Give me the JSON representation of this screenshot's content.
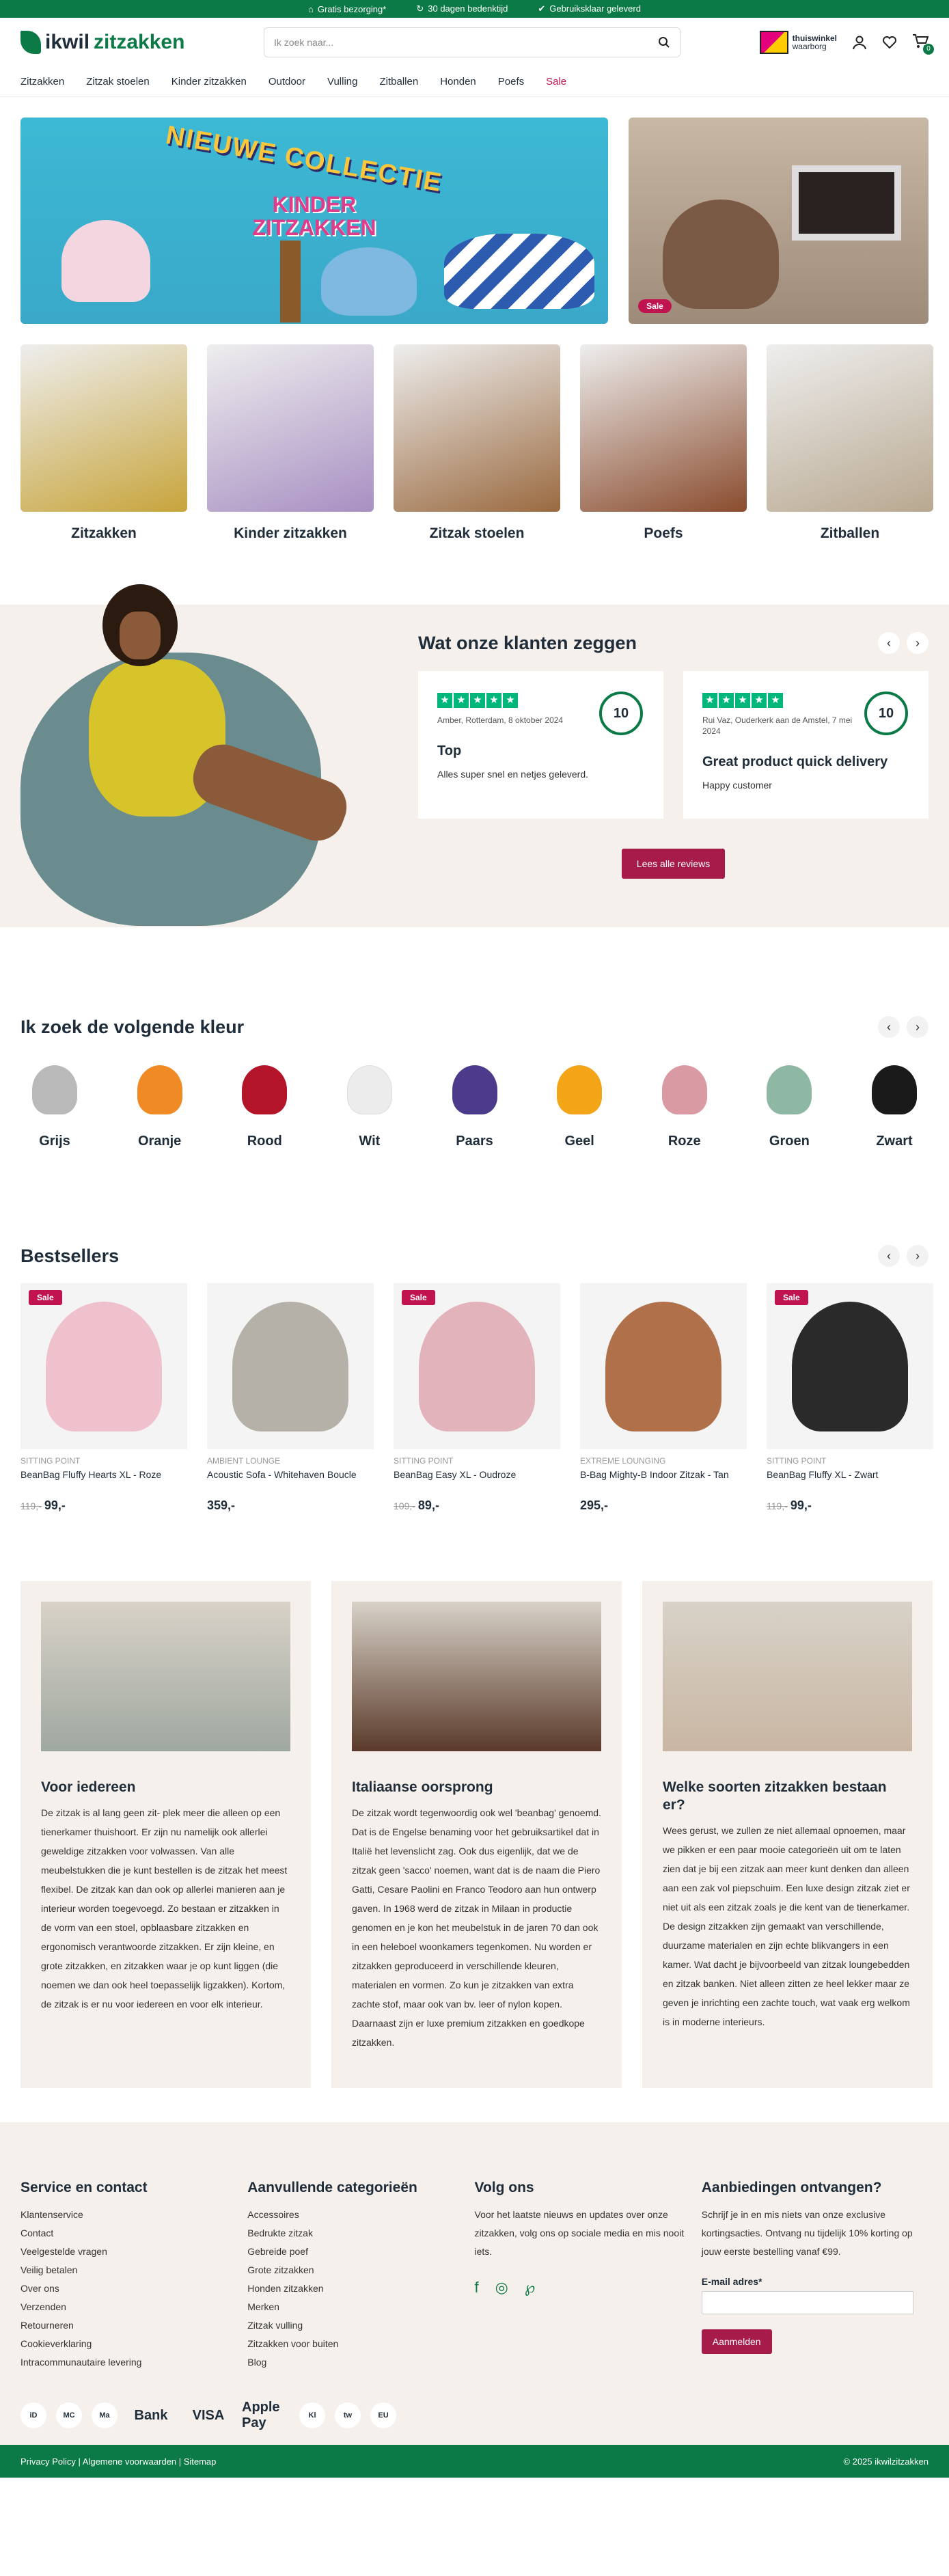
{
  "topbar": [
    "Gratis bezorging*",
    "30 dagen bedenktijd",
    "Gebruiksklaar geleverd"
  ],
  "header": {
    "logo_a": "ikwil",
    "logo_b": "zitzakken",
    "search_placeholder": "Ik zoek naar...",
    "thuiswinkel_1": "thuiswinkel",
    "thuiswinkel_2": "waarborg",
    "cart_count": "0"
  },
  "nav": [
    "Zitzakken",
    "Zitzak stoelen",
    "Kinder zitzakken",
    "Outdoor",
    "Vulling",
    "Zitballen",
    "Honden",
    "Poefs"
  ],
  "nav_sale": "Sale",
  "hero": {
    "title_1": "NIEUWE COLLECTIE",
    "title_2": "KINDER ZITZAKKEN",
    "side_badge": "Sale"
  },
  "categories": [
    {
      "label": "Zitzakken",
      "color": "#c7a43b"
    },
    {
      "label": "Kinder zitzakken",
      "color": "#a88fc2"
    },
    {
      "label": "Zitzak stoelen",
      "color": "#9a6a40"
    },
    {
      "label": "Poefs",
      "color": "#8a4c2e"
    },
    {
      "label": "Zitballen",
      "color": "#b8a890"
    }
  ],
  "reviews": {
    "title": "Wat onze klanten zeggen",
    "cards": [
      {
        "meta": "Amber, Rotterdam, 8 oktober 2024",
        "score": "10",
        "title": "Top",
        "text": "Alles super snel en netjes geleverd."
      },
      {
        "meta": "Rui Vaz, Ouderkerk aan de Amstel, 7 mei 2024",
        "score": "10",
        "title": "Great product quick delivery",
        "text": "Happy customer"
      }
    ],
    "button": "Lees alle reviews"
  },
  "colors_section": {
    "title": "Ik zoek de volgende kleur",
    "items": [
      {
        "label": "Grijs",
        "color": "#b9b9b9"
      },
      {
        "label": "Oranje",
        "color": "#f08a24"
      },
      {
        "label": "Rood",
        "color": "#b3142a"
      },
      {
        "label": "Wit",
        "color": "#ececec"
      },
      {
        "label": "Paars",
        "color": "#4c3a8a"
      },
      {
        "label": "Geel",
        "color": "#f4a417"
      },
      {
        "label": "Roze",
        "color": "#d99aa3"
      },
      {
        "label": "Groen",
        "color": "#8fb8a4"
      },
      {
        "label": "Zwart",
        "color": "#1a1a1a"
      }
    ]
  },
  "bestsellers": {
    "title": "Bestsellers",
    "sale_label": "Sale",
    "products": [
      {
        "brand": "SITTING POINT",
        "name": "BeanBag Fluffy Hearts XL - Roze",
        "old": "119,-",
        "price": "99,-",
        "sale": true,
        "color": "#efc1cd"
      },
      {
        "brand": "AMBIENT LOUNGE",
        "name": "Acoustic Sofa - Whitehaven Boucle",
        "old": "",
        "price": "359,-",
        "sale": false,
        "color": "#b5b1a8"
      },
      {
        "brand": "SITTING POINT",
        "name": "BeanBag Easy XL - Oudroze",
        "old": "109,-",
        "price": "89,-",
        "sale": true,
        "color": "#e3b3bc"
      },
      {
        "brand": "EXTREME LOUNGING",
        "name": "B-Bag Mighty-B Indoor Zitzak - Tan",
        "old": "",
        "price": "295,-",
        "sale": false,
        "color": "#b0704a"
      },
      {
        "brand": "SITTING POINT",
        "name": "BeanBag Fluffy XL - Zwart",
        "old": "119,-",
        "price": "99,-",
        "sale": true,
        "color": "#2a2a2a"
      }
    ]
  },
  "info": [
    {
      "title": "Voor iedereen",
      "color": "#9fa8a0",
      "text": "De zitzak is al lang geen zit- plek meer die alleen op een tienerkamer thuishoort. Er zijn nu namelijk ook allerlei geweldige zitzakken voor volwassen. Van alle meubelstukken die je kunt bestellen is de zitzak het meest flexibel. De zitzak kan dan ook op allerlei manieren aan je interieur worden toegevoegd. Zo bestaan er zitzakken in de vorm van een stoel, opblaasbare zitzakken en ergonomisch verantwoorde zitzakken. Er zijn kleine, en grote zitzakken, en zitzakken waar je op kunt liggen (die noemen we dan ook heel toepasselijk ligzakken). Kortom, de zitzak is er nu voor iedereen en voor elk interieur."
    },
    {
      "title": "Italiaanse oorsprong",
      "color": "#5a3a2a",
      "text": "De zitzak wordt tegenwoordig ook wel 'beanbag' genoemd. Dat is de Engelse benaming voor het gebruiksartikel dat in Italië het levenslicht zag. Ook dus eigenlijk, dat we de zitzak geen 'sacco' noemen, want dat is de naam die Piero Gatti, Cesare Paolini en Franco Teodoro aan hun ontwerp gaven. In 1968 werd de zitzak in Milaan in productie genomen en je kon het meubelstuk in de jaren 70 dan ook in een heleboel woonkamers tegenkomen. Nu worden er zitzakken geproduceerd in verschillende kleuren, materialen en vormen. Zo kun je zitzakken van extra zachte stof, maar ook van bv. leer of nylon kopen. Daarnaast zijn er luxe premium zitzakken en goedkope zitzakken."
    },
    {
      "title": "Welke soorten zitzakken bestaan er?",
      "color": "#c9b6a2",
      "text": "Wees gerust, we zullen ze niet allemaal opnoemen, maar we pikken er een paar mooie categorieën uit om te laten zien dat je bij een zitzak aan meer kunt denken dan alleen aan een zak vol piepschuim. Een luxe design zitzak ziet er niet uit als een zitzak zoals je die kent van de tienerkamer. De design zitzakken zijn gemaakt van verschillende, duurzame materialen en zijn echte blikvangers in een kamer. Wat dacht je bijvoorbeeld van zitzak loungebedden en zitzak banken. Niet alleen zitten ze heel lekker maar ze geven je inrichting een zachte touch, wat vaak erg welkom is in moderne interieurs."
    }
  ],
  "footer": {
    "col1_title": "Service en contact",
    "col1_links": [
      "Klantenservice",
      "Contact",
      "Veelgestelde vragen",
      "Veilig betalen",
      "Over ons",
      "Verzenden",
      "Retourneren",
      "Cookieverklaring",
      "Intracommunautaire levering"
    ],
    "col2_title": "Aanvullende categorieën",
    "col2_links": [
      "Accessoires",
      "Bedrukte zitzak",
      "Gebreide poef",
      "Grote zitzakken",
      "Honden zitzakken",
      "Merken",
      "Zitzak vulling",
      "Zitzakken voor buiten",
      "Blog"
    ],
    "col3_title": "Volg ons",
    "col3_text": "Voor het laatste nieuws en updates over onze zitzakken, volg ons op sociale media en mis nooit iets.",
    "col4_title": "Aanbiedingen ontvangen?",
    "col4_text": "Schrijf je in en mis niets van onze exclusive kortingsacties. Ontvang nu tijdelijk 10% korting op jouw eerste bestelling vanaf €99.",
    "email_label": "E-mail adres*",
    "subscribe": "Aanmelden",
    "payments": [
      "iD",
      "MC",
      "Ma",
      "Bank",
      "VISA",
      "Apple Pay",
      "Kl",
      "tw",
      "EU"
    ],
    "bottom_left": "Privacy Policy | Algemene voorwaarden | Sitemap",
    "bottom_right": "© 2025 ikwilzitzakken"
  }
}
